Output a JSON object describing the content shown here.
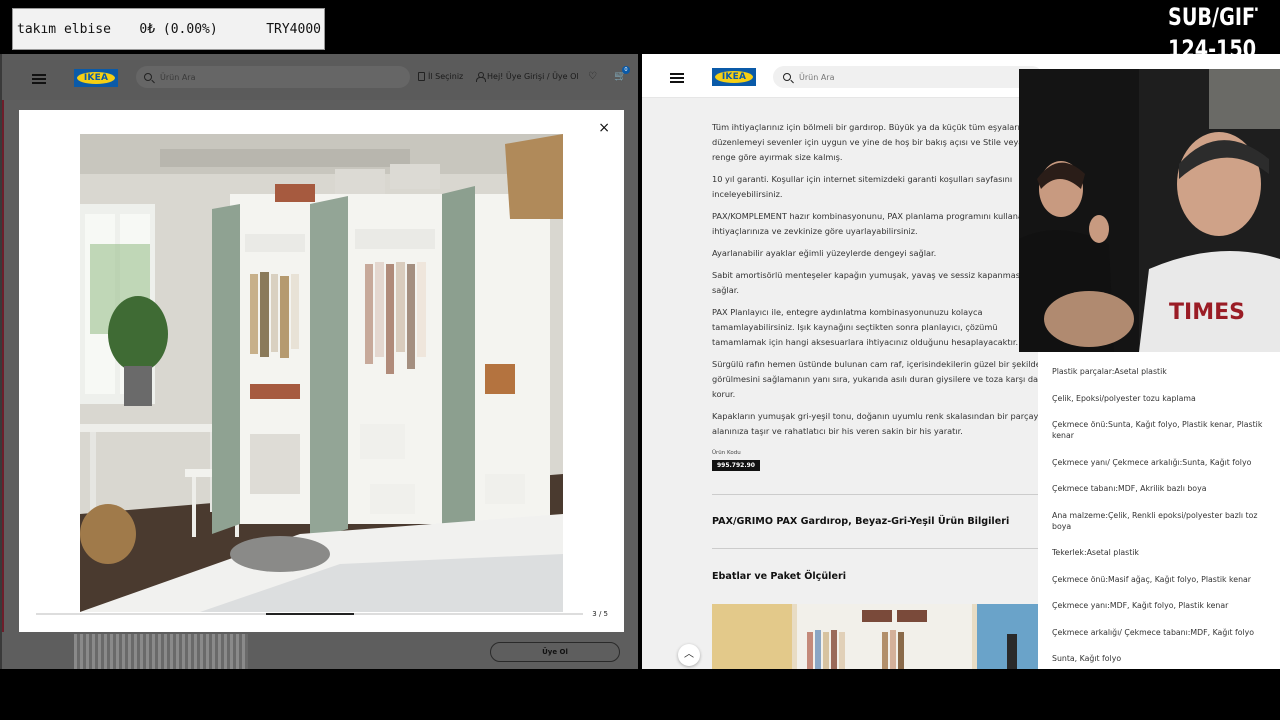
{
  "overlay": {
    "bid_item": "takım elbise",
    "bid_change": "0₺ (0.00%)",
    "bid_amount": "TRY4000",
    "subgift_line1": "SUB/GIFT",
    "subgift_line2": "124-150"
  },
  "left_browser": {
    "logo": "IKEA",
    "search_placeholder": "Ürün Ara",
    "store_link": "İl Seçiniz",
    "account_link": "Hej! Üye Girişi / Üye Ol",
    "cart_count": "0",
    "modal": {
      "close_label": "×",
      "counter": "3 / 5",
      "slide_index": 3,
      "slide_total": 5
    },
    "signup_button": "Üye Ol"
  },
  "right_browser": {
    "logo": "IKEA",
    "search_placeholder": "Ürün Ara",
    "description": [
      "Tüm ihtiyaçlarınız için bölmeli bir gardırop. Büyük ya da küçük tüm eşyalarını düzenlemeyi sevenler için uygun ve yine de hoş bir bakış açısı ve Stile veya renge göre ayırmak size kalmış.",
      "10 yıl garanti. Koşullar için internet sitemizdeki garanti koşulları sayfasını inceleyebilirsiniz.",
      "PAX/KOMPLEMENT hazır kombinasyonunu, PAX planlama programını kullanarak ihtiyaçlarınıza ve zevkinize göre uyarlayabilirsiniz.",
      "Ayarlanabilir ayaklar eğimli yüzeylerde dengeyi sağlar.",
      "Sabit amortisörlü menteşeler kapağın yumuşak, yavaş ve sessiz kapanmasını sağlar.",
      "PAX Planlayıcı ile, entegre aydınlatma kombinasyonunuzu kolayca tamamlayabilirsiniz. Işık kaynağını seçtikten sonra planlayıcı, çözümü tamamlamak için hangi aksesuarlara ihtiyacınız olduğunu hesaplayacaktır.",
      "Sürgülü rafın hemen üstünde bulunan cam raf, içerisindekilerin güzel bir şekilde görülmesini sağlamanın yanı sıra, yukarıda asılı duran giysilere ve toza karşı da korur.",
      "Kapakların yumuşak gri-yeşil tonu, doğanın uyumlu renk skalasından bir parçayı alanınıza taşır ve rahatlatıcı bir his veren sakin bir his yaratır."
    ],
    "product_code_label": "Ürün Kodu",
    "product_code": "995.792.90",
    "section_info": "PAX/GRIMO PAX Gardırop, Beyaz-Gri-Yeşil Ürün Bilgileri",
    "section_dims": "Ebatlar ve Paket Ölçüleri",
    "scroll_top": "︿",
    "materials": [
      "Plastik parçalar:Asetal plastik",
      "Çelik, Epoksi/polyester tozu kaplama",
      "Çekmece önü:Sunta, Kağıt folyo, Plastik kenar, Plastik kenar",
      "Çekmece yanı/ Çekmece arkalığı:Sunta, Kağıt folyo",
      "Çekmece tabanı:MDF, Akrilik bazlı boya",
      "Ana malzeme:Çelik, Renkli epoksi/polyester bazlı toz boya",
      "Tekerlek:Asetal plastik",
      "Çekmece önü:Masif ağaç, Kağıt folyo, Plastik kenar",
      "Çekmece yanı:MDF, Kağıt folyo, Plastik kenar",
      "Çekmece arkalığı/ Çekmece tabanı:MDF, Kağıt folyo",
      "Sunta, Kağıt folyo"
    ]
  },
  "colors": {
    "ikea_blue": "#0a5aa8",
    "ikea_yellow": "#f5cf14",
    "door_green": "#8fa292"
  }
}
